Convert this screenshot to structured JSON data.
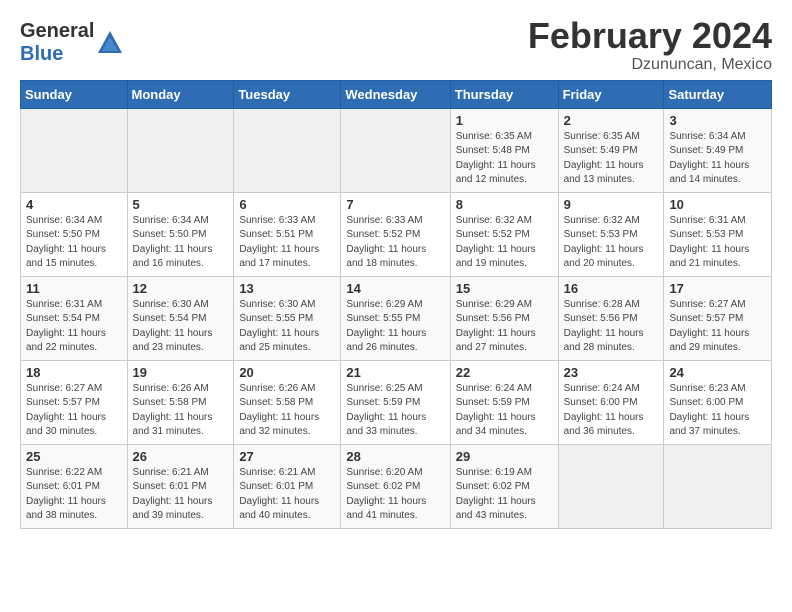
{
  "header": {
    "logo_general": "General",
    "logo_blue": "Blue",
    "month_title": "February 2024",
    "location": "Dzununcan, Mexico"
  },
  "days_of_week": [
    "Sunday",
    "Monday",
    "Tuesday",
    "Wednesday",
    "Thursday",
    "Friday",
    "Saturday"
  ],
  "weeks": [
    [
      {
        "day": "",
        "info": ""
      },
      {
        "day": "",
        "info": ""
      },
      {
        "day": "",
        "info": ""
      },
      {
        "day": "",
        "info": ""
      },
      {
        "day": "1",
        "info": "Sunrise: 6:35 AM\nSunset: 5:48 PM\nDaylight: 11 hours\nand 12 minutes."
      },
      {
        "day": "2",
        "info": "Sunrise: 6:35 AM\nSunset: 5:49 PM\nDaylight: 11 hours\nand 13 minutes."
      },
      {
        "day": "3",
        "info": "Sunrise: 6:34 AM\nSunset: 5:49 PM\nDaylight: 11 hours\nand 14 minutes."
      }
    ],
    [
      {
        "day": "4",
        "info": "Sunrise: 6:34 AM\nSunset: 5:50 PM\nDaylight: 11 hours\nand 15 minutes."
      },
      {
        "day": "5",
        "info": "Sunrise: 6:34 AM\nSunset: 5:50 PM\nDaylight: 11 hours\nand 16 minutes."
      },
      {
        "day": "6",
        "info": "Sunrise: 6:33 AM\nSunset: 5:51 PM\nDaylight: 11 hours\nand 17 minutes."
      },
      {
        "day": "7",
        "info": "Sunrise: 6:33 AM\nSunset: 5:52 PM\nDaylight: 11 hours\nand 18 minutes."
      },
      {
        "day": "8",
        "info": "Sunrise: 6:32 AM\nSunset: 5:52 PM\nDaylight: 11 hours\nand 19 minutes."
      },
      {
        "day": "9",
        "info": "Sunrise: 6:32 AM\nSunset: 5:53 PM\nDaylight: 11 hours\nand 20 minutes."
      },
      {
        "day": "10",
        "info": "Sunrise: 6:31 AM\nSunset: 5:53 PM\nDaylight: 11 hours\nand 21 minutes."
      }
    ],
    [
      {
        "day": "11",
        "info": "Sunrise: 6:31 AM\nSunset: 5:54 PM\nDaylight: 11 hours\nand 22 minutes."
      },
      {
        "day": "12",
        "info": "Sunrise: 6:30 AM\nSunset: 5:54 PM\nDaylight: 11 hours\nand 23 minutes."
      },
      {
        "day": "13",
        "info": "Sunrise: 6:30 AM\nSunset: 5:55 PM\nDaylight: 11 hours\nand 25 minutes."
      },
      {
        "day": "14",
        "info": "Sunrise: 6:29 AM\nSunset: 5:55 PM\nDaylight: 11 hours\nand 26 minutes."
      },
      {
        "day": "15",
        "info": "Sunrise: 6:29 AM\nSunset: 5:56 PM\nDaylight: 11 hours\nand 27 minutes."
      },
      {
        "day": "16",
        "info": "Sunrise: 6:28 AM\nSunset: 5:56 PM\nDaylight: 11 hours\nand 28 minutes."
      },
      {
        "day": "17",
        "info": "Sunrise: 6:27 AM\nSunset: 5:57 PM\nDaylight: 11 hours\nand 29 minutes."
      }
    ],
    [
      {
        "day": "18",
        "info": "Sunrise: 6:27 AM\nSunset: 5:57 PM\nDaylight: 11 hours\nand 30 minutes."
      },
      {
        "day": "19",
        "info": "Sunrise: 6:26 AM\nSunset: 5:58 PM\nDaylight: 11 hours\nand 31 minutes."
      },
      {
        "day": "20",
        "info": "Sunrise: 6:26 AM\nSunset: 5:58 PM\nDaylight: 11 hours\nand 32 minutes."
      },
      {
        "day": "21",
        "info": "Sunrise: 6:25 AM\nSunset: 5:59 PM\nDaylight: 11 hours\nand 33 minutes."
      },
      {
        "day": "22",
        "info": "Sunrise: 6:24 AM\nSunset: 5:59 PM\nDaylight: 11 hours\nand 34 minutes."
      },
      {
        "day": "23",
        "info": "Sunrise: 6:24 AM\nSunset: 6:00 PM\nDaylight: 11 hours\nand 36 minutes."
      },
      {
        "day": "24",
        "info": "Sunrise: 6:23 AM\nSunset: 6:00 PM\nDaylight: 11 hours\nand 37 minutes."
      }
    ],
    [
      {
        "day": "25",
        "info": "Sunrise: 6:22 AM\nSunset: 6:01 PM\nDaylight: 11 hours\nand 38 minutes."
      },
      {
        "day": "26",
        "info": "Sunrise: 6:21 AM\nSunset: 6:01 PM\nDaylight: 11 hours\nand 39 minutes."
      },
      {
        "day": "27",
        "info": "Sunrise: 6:21 AM\nSunset: 6:01 PM\nDaylight: 11 hours\nand 40 minutes."
      },
      {
        "day": "28",
        "info": "Sunrise: 6:20 AM\nSunset: 6:02 PM\nDaylight: 11 hours\nand 41 minutes."
      },
      {
        "day": "29",
        "info": "Sunrise: 6:19 AM\nSunset: 6:02 PM\nDaylight: 11 hours\nand 43 minutes."
      },
      {
        "day": "",
        "info": ""
      },
      {
        "day": "",
        "info": ""
      }
    ]
  ]
}
